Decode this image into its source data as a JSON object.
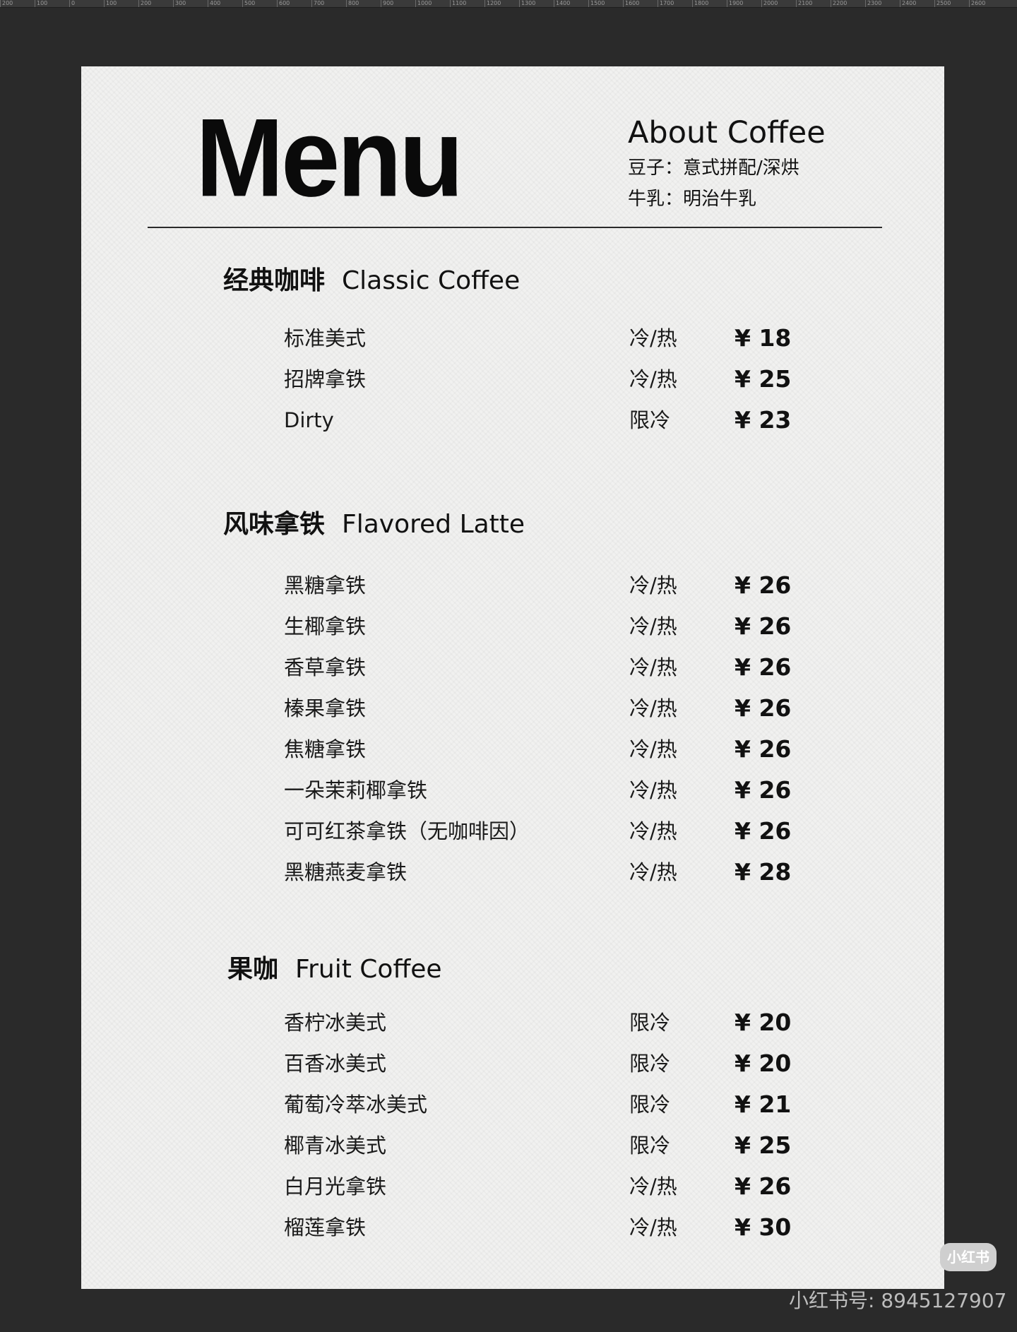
{
  "ruler": {
    "ticks": [
      "200",
      "100",
      "0",
      "100",
      "200",
      "300",
      "400",
      "500",
      "600",
      "700",
      "800",
      "900",
      "1000",
      "1100",
      "1200",
      "1300",
      "1400",
      "1500",
      "1600",
      "1700",
      "1800",
      "1900",
      "2000",
      "2100",
      "2200",
      "2300",
      "2400",
      "2500",
      "2600"
    ]
  },
  "header": {
    "title": "Menu",
    "about_title": "About Coffee",
    "beans": "豆子：意式拼配/深烘",
    "milk": "牛乳：明治牛乳"
  },
  "sections": [
    {
      "cn": "经典咖啡",
      "en": "Classic Coffee",
      "items": [
        {
          "name": "标准美式",
          "temp": "冷/热",
          "price": "¥ 18"
        },
        {
          "name": "招牌拿铁",
          "temp": "冷/热",
          "price": "¥ 25"
        },
        {
          "name": "Dirty",
          "temp": "限冷",
          "price": "¥ 23"
        }
      ]
    },
    {
      "cn": "风味拿铁",
      "en": "Flavored Latte",
      "items": [
        {
          "name": "黑糖拿铁",
          "temp": "冷/热",
          "price": "¥ 26"
        },
        {
          "name": "生椰拿铁",
          "temp": "冷/热",
          "price": "¥ 26"
        },
        {
          "name": "香草拿铁",
          "temp": "冷/热",
          "price": "¥ 26"
        },
        {
          "name": "榛果拿铁",
          "temp": "冷/热",
          "price": "¥ 26"
        },
        {
          "name": "焦糖拿铁",
          "temp": "冷/热",
          "price": "¥ 26"
        },
        {
          "name": "一朵茉莉椰拿铁",
          "temp": "冷/热",
          "price": "¥ 26"
        },
        {
          "name": "可可红茶拿铁（无咖啡因）",
          "temp": "冷/热",
          "price": "¥ 26"
        },
        {
          "name": "黑糖燕麦拿铁",
          "temp": "冷/热",
          "price": "¥ 28"
        }
      ]
    },
    {
      "cn": "果咖",
      "en": "Fruit Coffee",
      "items": [
        {
          "name": "香柠冰美式",
          "temp": "限冷",
          "price": "¥ 20"
        },
        {
          "name": "百香冰美式",
          "temp": "限冷",
          "price": "¥ 20"
        },
        {
          "name": "葡萄冷萃冰美式",
          "temp": "限冷",
          "price": "¥ 21"
        },
        {
          "name": "椰青冰美式",
          "temp": "限冷",
          "price": "¥ 25"
        },
        {
          "name": "白月光拿铁",
          "temp": "冷/热",
          "price": "¥ 26"
        },
        {
          "name": "榴莲拿铁",
          "temp": "冷/热",
          "price": "¥ 30"
        }
      ]
    }
  ],
  "footer": {
    "badge": "小红书",
    "watermark": "小红书号: 8945127907"
  }
}
